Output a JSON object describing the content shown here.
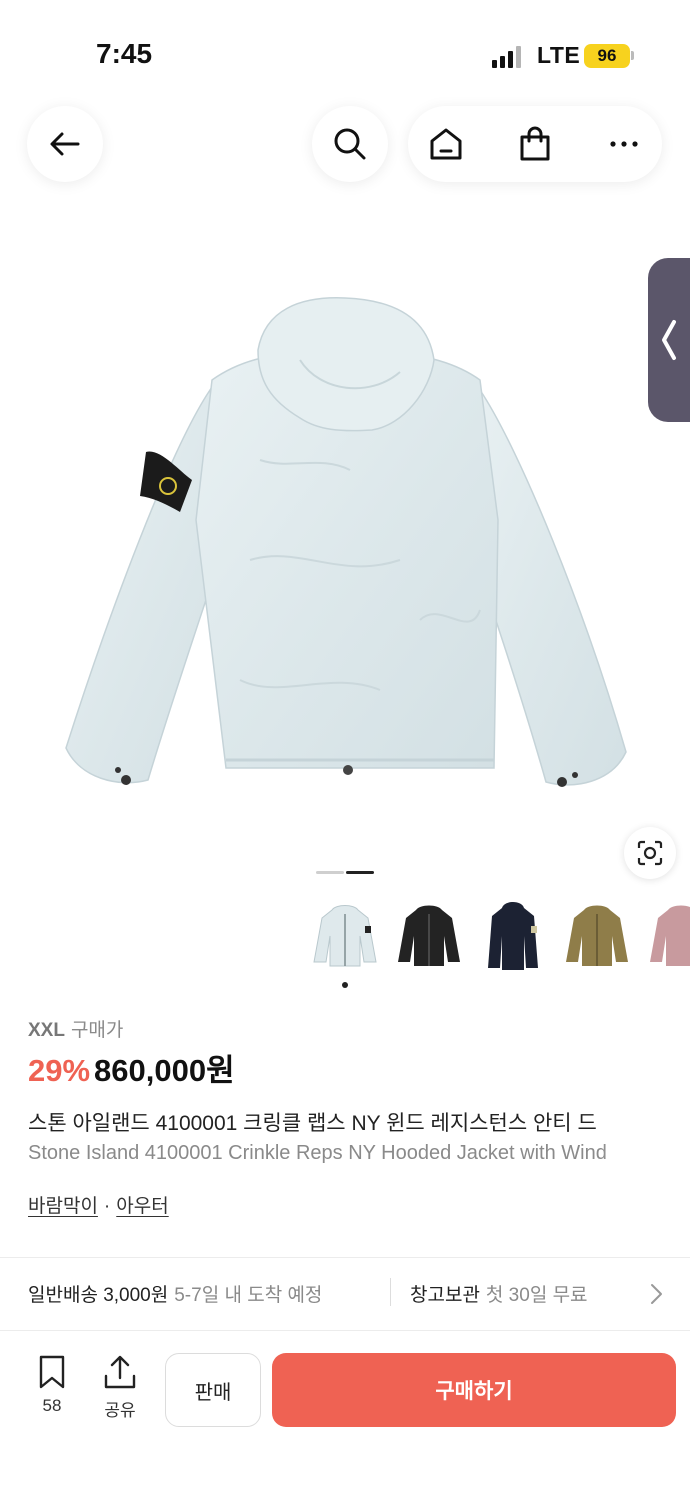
{
  "status_bar": {
    "time": "7:45",
    "network": "LTE",
    "battery": "96"
  },
  "colors": {
    "accent": "#ef6253",
    "side_tab": "#5b566a",
    "battery": "#f7d21e"
  },
  "nav": {
    "icons": [
      "back-arrow-icon",
      "search-icon",
      "home-icon",
      "shopping-bag-icon",
      "more-icon"
    ]
  },
  "product": {
    "size": "XXL",
    "size_suffix": "구매가",
    "discount": "29%",
    "price": "860,000원",
    "title_ko": "스톤 아일랜드 4100001 크링클 랩스 NY 윈드 레지스턴스 안티 드",
    "title_en": "Stone Island 4100001 Crinkle Reps NY Hooded Jacket with Wind",
    "categories": [
      "바람막이",
      "아우터"
    ],
    "category_separator": "·",
    "color_thumbnails": [
      "light blue",
      "black",
      "navy",
      "olive",
      "pink"
    ],
    "image_index": {
      "current": 2,
      "total": 2
    }
  },
  "shipping": {
    "label": "일반배송 3,000원",
    "eta": "5-7일 내 도착 예정",
    "storage_label": "창고보관",
    "storage_note": "첫 30일 무료"
  },
  "bottom_bar": {
    "bookmark_count": "58",
    "share_label": "공유",
    "sell_label": "판매",
    "buy_label": "구매하기"
  }
}
